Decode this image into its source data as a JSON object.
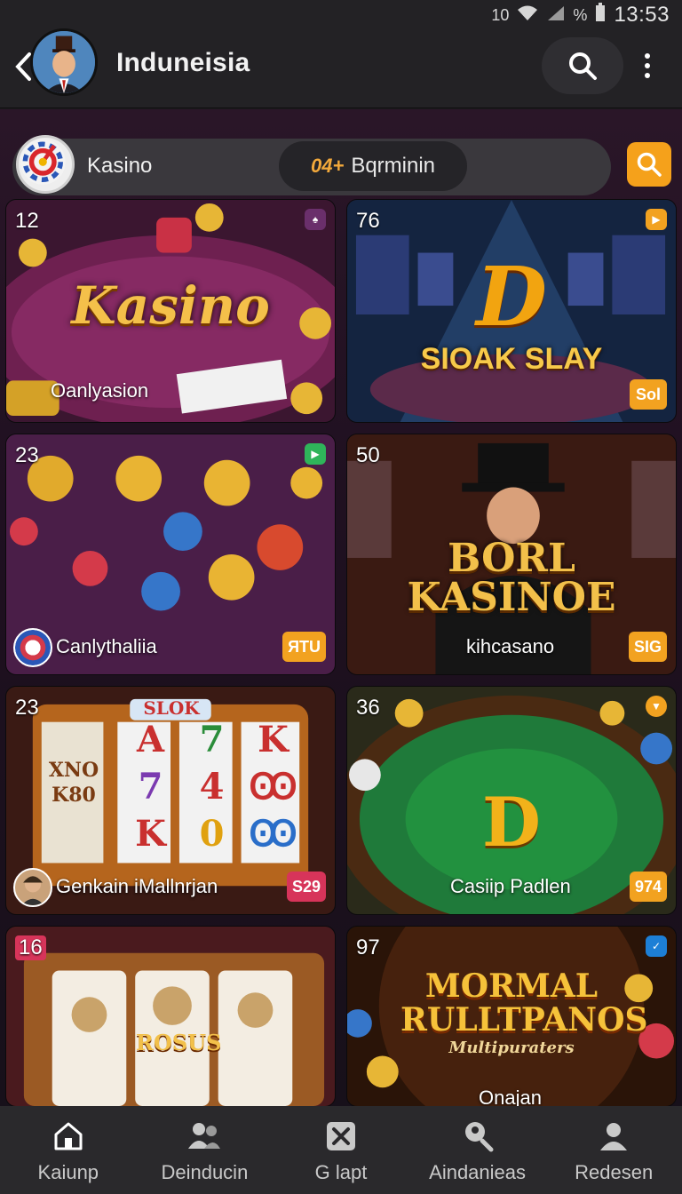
{
  "status_bar": {
    "time": "13:53",
    "signal_text": "10",
    "battery_text": "%"
  },
  "app_bar": {
    "title": "Induneisia"
  },
  "filter": {
    "label": "Kasino",
    "pill_number": "04+",
    "pill_label": "Bqrminin"
  },
  "tiles": [
    {
      "count": "12",
      "title_art": "Kasino",
      "label": "Oanlyasion",
      "tag": "",
      "badge_color": "#6a2f6b"
    },
    {
      "count": "76",
      "title_art": "SIOAK SLAY",
      "label": "",
      "tag": "Sol",
      "badge_color": "#f2a220"
    },
    {
      "count": "23",
      "title_art": "",
      "label": "Canlythaliia",
      "tag": "ЯTU",
      "badge_color": "#2fb45a"
    },
    {
      "count": "50",
      "title_art": "BORL KASINOE",
      "label": "kihcasano",
      "tag": "SIG",
      "badge_color": ""
    },
    {
      "count": "23",
      "title_art": "SLOK",
      "label": "Genkain iMallnrjan",
      "tag": "S29",
      "badge_color": ""
    },
    {
      "count": "36",
      "title_art": "",
      "label": "Casiip Padlen",
      "tag": "974",
      "badge_color": "#f2a220"
    },
    {
      "count": "16",
      "title_art": "ROSUS",
      "label": "",
      "tag": "",
      "badge_color": ""
    },
    {
      "count": "97",
      "title_art": "MORMAL RULLTPANOS",
      "subtitle_art": "Multipuraters",
      "label": "Onajan",
      "tag": "",
      "badge_color": "#1d7fd6"
    }
  ],
  "reel_symbols": [
    "A",
    "7",
    "K",
    "7",
    "4",
    "Ꙭ",
    "K",
    "0",
    "Ꙭ"
  ],
  "reel_left_text": "XNO K80",
  "bottom_nav": [
    {
      "label": "Kaiunp",
      "icon": "home-icon"
    },
    {
      "label": "Deinducin",
      "icon": "people-icon"
    },
    {
      "label": "G lapt",
      "icon": "close-box-icon"
    },
    {
      "label": "Aindanieas",
      "icon": "search-people-icon"
    },
    {
      "label": "Redesen",
      "icon": "profile-icon"
    }
  ],
  "colors": {
    "accent": "#f5a11b",
    "tag_orange": "#f2a220",
    "tag_red": "#d7345a",
    "background": "#1b1a1d"
  }
}
